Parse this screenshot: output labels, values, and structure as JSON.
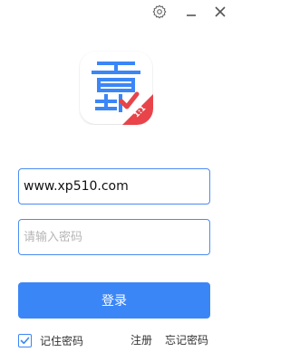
{
  "titlebar": {
    "icons": {
      "settings": "gear-icon",
      "minimize": "minimize-icon",
      "close": "close-icon"
    }
  },
  "logo": {
    "badge_text": "1:1",
    "colors": {
      "blue": "#3b86f7",
      "red": "#e8444a"
    }
  },
  "form": {
    "username_value": "www.xp510.com",
    "password_placeholder": "请输入密码",
    "login_label": "登录",
    "remember_label": "记住密码",
    "remember_checked": true,
    "register_label": "注册",
    "forgot_label": "忘记密码"
  },
  "colors": {
    "accent": "#3b86f7",
    "input_border": "#4a8cf0"
  }
}
